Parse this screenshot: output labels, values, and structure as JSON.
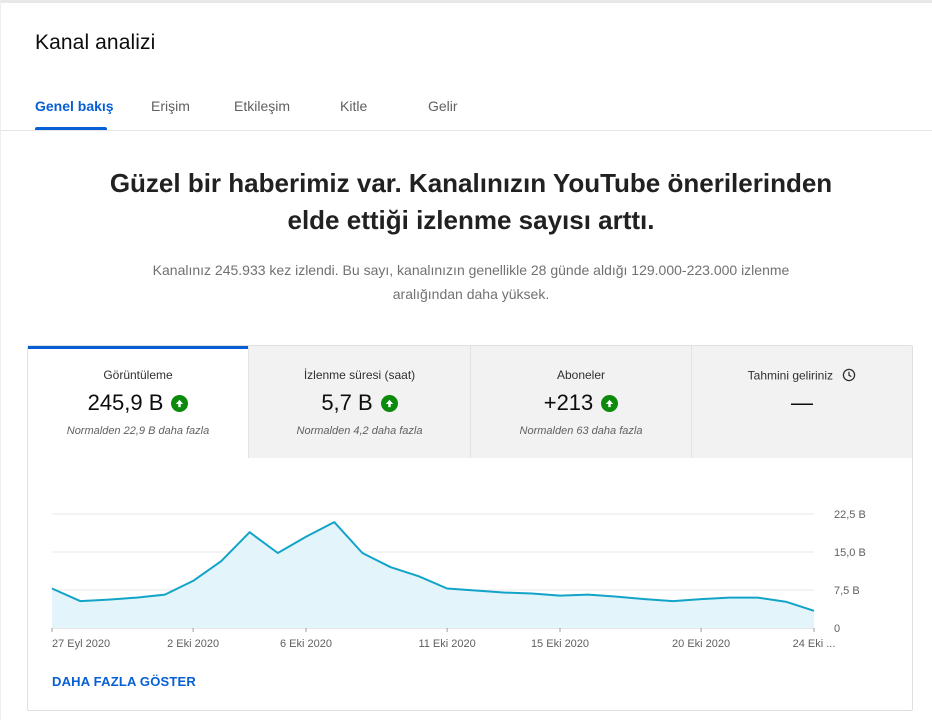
{
  "header": {
    "title": "Kanal analizi"
  },
  "tabs": [
    {
      "label": "Genel bakış",
      "active": true
    },
    {
      "label": "Erişim",
      "active": false
    },
    {
      "label": "Etkileşim",
      "active": false
    },
    {
      "label": "Kitle",
      "active": false
    },
    {
      "label": "Gelir",
      "active": false
    }
  ],
  "banner": {
    "headline_line1": "Güzel bir haberimiz var. Kanalınızın YouTube önerilerinden",
    "headline_line2": "elde ettiği izlenme sayısı arttı.",
    "subtext_line1": "Kanalınız 245.933 kez izlendi. Bu sayı, kanalınızın genellikle 28 günde aldığı 129.000-223.000 izlenme",
    "subtext_line2": "aralığından daha yüksek."
  },
  "metrics": [
    {
      "label": "Görüntüleme",
      "value": "245,9 B",
      "note": "Normalden 22,9 B daha fazla",
      "icon": "arrow-up-icon"
    },
    {
      "label": "İzlenme süresi (saat)",
      "value": "5,7 B",
      "note": "Normalden 4,2 daha fazla",
      "icon": "arrow-up-icon"
    },
    {
      "label": "Aboneler",
      "value": "+213",
      "note": "Normalden 63 daha fazla",
      "icon": "arrow-up-icon"
    },
    {
      "label": "Tahmini geliriniz",
      "value": "—",
      "icon": "clock-icon"
    }
  ],
  "colors": {
    "accent": "#065fd4",
    "up": "#0b8a0b",
    "line": "#12a4c8",
    "fill": "#e3f4fa"
  },
  "chart_data": {
    "type": "area",
    "x": [
      "27 Eyl 2020",
      "28 Eyl",
      "29 Eyl",
      "30 Eyl",
      "1 Eki",
      "2 Eki 2020",
      "3 Eki",
      "4 Eki",
      "5 Eki",
      "6 Eki 2020",
      "7 Eki",
      "8 Eki",
      "9 Eki",
      "10 Eki",
      "11 Eki 2020",
      "12 Eki",
      "13 Eki",
      "14 Eki",
      "15 Eki 2020",
      "16 Eki",
      "17 Eki",
      "18 Eki",
      "19 Eki",
      "20 Eki 2020",
      "21 Eki",
      "22 Eki",
      "23 Eki",
      "24 Eki"
    ],
    "values": [
      7.8,
      5.3,
      5.6,
      6.0,
      6.6,
      9.3,
      13.2,
      18.9,
      14.8,
      18.0,
      20.9,
      14.8,
      12.0,
      10.2,
      7.8,
      7.4,
      7.0,
      6.8,
      6.4,
      6.6,
      6.2,
      5.7,
      5.3,
      5.7,
      6.0,
      6.0,
      5.2,
      3.4
    ],
    "x_tick_labels": [
      "27 Eyl 2020",
      "2 Eki 2020",
      "6 Eki 2020",
      "11 Eki 2020",
      "15 Eki 2020",
      "20 Eki 2020",
      "24 Eki ..."
    ],
    "x_tick_index": [
      0,
      5,
      9,
      14,
      18,
      23,
      27
    ],
    "y_ticks": [
      0,
      7.5,
      15,
      22.5
    ],
    "y_tick_labels": [
      "0",
      "7,5 B",
      "15,0 B",
      "22,5 B"
    ],
    "ylim": [
      0,
      22.5
    ],
    "grid": true
  },
  "footer": {
    "more_label": "DAHA FAZLA GÖSTER"
  }
}
